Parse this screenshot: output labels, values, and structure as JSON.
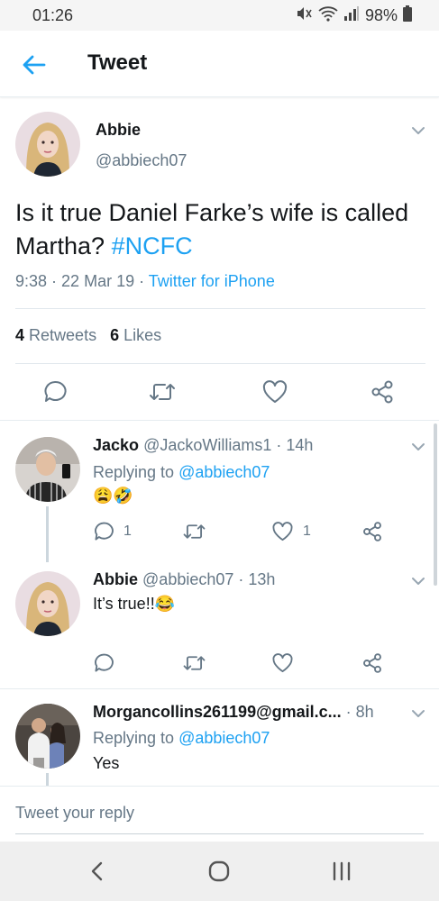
{
  "status_bar": {
    "time": "01:26",
    "battery": "98%"
  },
  "header": {
    "title": "Tweet"
  },
  "tweet": {
    "name": "Abbie",
    "handle": "@abbiech07",
    "text": "Is it true Daniel Farke’s wife is called Martha?",
    "hashtag": "#NCFC",
    "time": "9:38",
    "date": "22 Mar 19",
    "source": "Twitter for iPhone",
    "retweets_count": "4",
    "retweets_label": "Retweets",
    "likes_count": "6",
    "likes_label": "Likes"
  },
  "replies": [
    {
      "name": "Jacko",
      "handle": "@JackoWilliams1",
      "age": "14h",
      "replying_prefix": "Replying to",
      "replying_to": "@abbiech07",
      "text": "",
      "emoji": "😩🤣",
      "reply_count": "1",
      "like_count": "1"
    },
    {
      "name": "Abbie",
      "handle": "@abbiech07",
      "age": "13h",
      "text": "It’s true!!",
      "emoji": "😂"
    },
    {
      "name": "Morgancollins261199@gmail.c...",
      "age": "8h",
      "replying_prefix": "Replying to",
      "replying_to": "@abbiech07",
      "text": "Yes"
    }
  ],
  "reply_box": {
    "placeholder": "Tweet your reply"
  },
  "colors": {
    "accent": "#1da1f2",
    "muted": "#657786",
    "text": "#14171a",
    "divider": "#e1e8ed"
  }
}
